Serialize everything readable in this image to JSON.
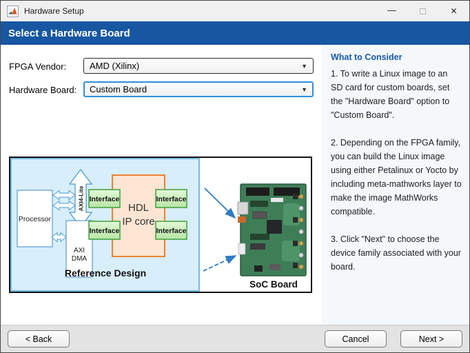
{
  "window": {
    "title": "Hardware Setup",
    "controls": {
      "minimize_glyph": "—",
      "close_glyph": "✕"
    }
  },
  "header": {
    "title": "Select a Hardware Board"
  },
  "form": {
    "fpga_vendor": {
      "label": "FPGA Vendor:",
      "value": "AMD (Xilinx)"
    },
    "hardware_board": {
      "label": "Hardware Board:",
      "value": "Custom Board"
    },
    "dropdown_arrow": "▼"
  },
  "diagram": {
    "processor": "Processor",
    "axi4_lite": "AXI4-Lite",
    "axi_dma": {
      "line1": "AXI",
      "line2": "DMA"
    },
    "hdl_ip_core": {
      "line1": "HDL",
      "line2": "IP core"
    },
    "interface": "Interface",
    "reference_design": "Reference Design",
    "soc_board": "SoC Board"
  },
  "sidebar": {
    "heading": "What to Consider",
    "paragraphs": [
      "1. To write a Linux image to an SD card for custom boards, set the \"Hardware Board\" option to \"Custom Board\".",
      "2. Depending on the FPGA family, you can build the Linux image using either Petalinux or Yocto by including meta-mathworks layer to make the image MathWorks compatible.",
      "3. Click \"Next\" to choose the device family associated with your board."
    ]
  },
  "footer": {
    "back_label": "< Back",
    "cancel_label": "Cancel",
    "next_label": "Next >"
  },
  "colors": {
    "header_blue": "#1757A2",
    "sidebar_heading_blue": "#1559A8",
    "sidebar_bg": "#F5F8FB",
    "focus_border_blue": "#2F8FD6",
    "footer_bg": "#E3E3E3",
    "diagram_box_blue": "#D8EEFB",
    "hdl_box_peach": "#FCE5D2",
    "interface_green": "#CDEFC0"
  }
}
